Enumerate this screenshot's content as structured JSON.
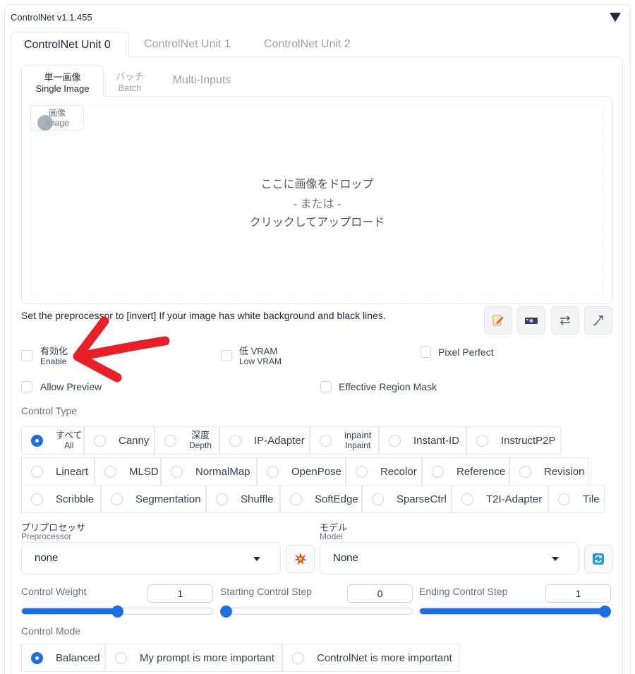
{
  "panel": {
    "title": "ControlNet v1.1.455"
  },
  "unit_tabs": [
    "ControlNet Unit 0",
    "ControlNet Unit 1",
    "ControlNet Unit 2"
  ],
  "input_tabs": {
    "single": {
      "jp": "単一画像",
      "en": "Single Image"
    },
    "batch": {
      "jp": "バッチ",
      "en": "Batch"
    },
    "multi": "Multi-Inputs"
  },
  "image_label": {
    "jp": "画像",
    "en": "Image"
  },
  "drop": {
    "line1": "ここに画像をドロップ",
    "line2": "- または -",
    "line3": "クリックしてアップロード"
  },
  "hint": "Set the preprocessor to [invert] If your image has white background and black lines.",
  "toolbar_icons": [
    "edit-icon",
    "camera-icon",
    "swap-icon",
    "resize-curve-icon"
  ],
  "checkboxes": {
    "enable": {
      "jp": "有効化",
      "en": "Enable"
    },
    "low_vram": {
      "jp": "低 VRAM",
      "en": "Low VRAM"
    },
    "pixel_perfect": "Pixel Perfect",
    "allow_preview": "Allow Preview",
    "effective_region_mask": "Effective Region Mask"
  },
  "control_type": {
    "label": "Control Type",
    "selected": "すべて",
    "row1": [
      {
        "jp": "すべて",
        "en": "All"
      },
      {
        "label": "Canny"
      },
      {
        "jp": "深度",
        "en": "Depth"
      },
      {
        "label": "IP-Adapter"
      },
      {
        "jp": "inpaint",
        "en": "Inpaint"
      },
      {
        "label": "Instant-ID"
      },
      {
        "label": "InstructP2P"
      }
    ],
    "row2": [
      "Lineart",
      "MLSD",
      "NormalMap",
      "OpenPose",
      "Recolor",
      "Reference",
      "Revision"
    ],
    "row3": [
      "Scribble",
      "Segmentation",
      "Shuffle",
      "SoftEdge",
      "SparseCtrl",
      "T2I-Adapter",
      "Tile"
    ]
  },
  "preprocessor": {
    "jp": "プリプロセッサ",
    "en": "Preprocessor",
    "value": "none"
  },
  "model": {
    "jp": "モデル",
    "en": "Model",
    "value": "None"
  },
  "sliders": {
    "weight": {
      "label": "Control Weight",
      "value": "1",
      "fraction": 0.5
    },
    "start": {
      "label": "Starting Control Step",
      "value": "0",
      "fraction": 0.0
    },
    "end": {
      "label": "Ending Control Step",
      "value": "1",
      "fraction": 1.0
    }
  },
  "control_mode": {
    "label": "Control Mode",
    "options": [
      "Balanced",
      "My prompt is more important",
      "ControlNet is more important"
    ],
    "selected": "Balanced"
  },
  "colors": {
    "accent": "#1d6fe0",
    "annotation_arrow": "#e8202a",
    "preprocessor_button": "#e8452a",
    "model_refresh": "#1f9ad6"
  }
}
